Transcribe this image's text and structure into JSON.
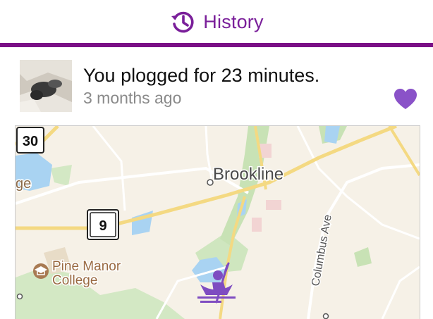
{
  "header": {
    "title": "History",
    "accent_color": "#7a0f86",
    "icon": "history-clock-icon"
  },
  "post": {
    "title": "You plogged for 23 minutes.",
    "time_ago": "3 months ago",
    "liked": true,
    "like_icon": "heart-icon",
    "like_color": "#8a52c8"
  },
  "map": {
    "place_labels": {
      "brookline": "Brookline",
      "edge": "ge",
      "pine_manor_line1": "Pine Manor",
      "pine_manor_line2": "College",
      "street": "Columbus Ave"
    },
    "route_shields": {
      "shield_30": "30",
      "shield_9": "9"
    },
    "activity_icon": "rowing-icon",
    "activity_color": "#7e4cc1"
  }
}
